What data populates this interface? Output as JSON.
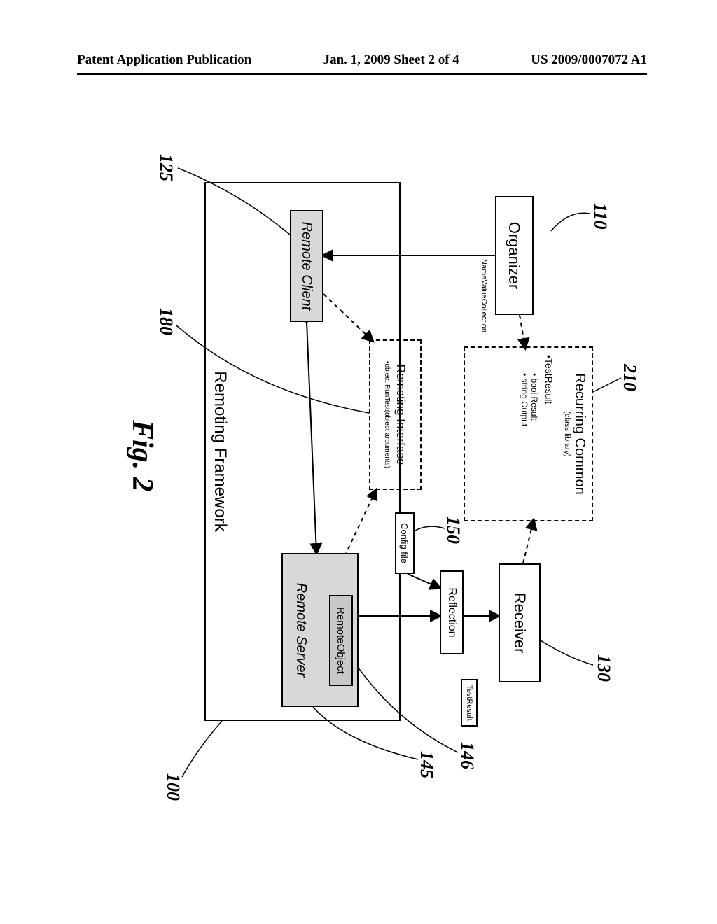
{
  "header": {
    "left": "Patent Application Publication",
    "center": "Jan. 1, 2009  Sheet 2 of 4",
    "right": "US 2009/0007072 A1"
  },
  "figure_caption": "Fig. 2",
  "callouts": {
    "c110": "110",
    "c210": "210",
    "c130": "130",
    "c150": "150",
    "c146": "146",
    "c145": "145",
    "c125": "125",
    "c180": "180",
    "c100": "100"
  },
  "boxes": {
    "organizer": "Organizer",
    "receiver": "Receiver",
    "reflection": "Reflection",
    "config_file": "Config file",
    "test_result_lbl": "TestResult",
    "remote_client": "Remote Client",
    "remote_server": "Remote Server",
    "remote_object": "RemoteObject",
    "remoting_framework": "Remoting Framework",
    "recurring_common_title": "Recurring Common",
    "recurring_common_sub": "(class library)",
    "rc_testresult": "•TestResult",
    "rc_bool": "• bool Result",
    "rc_string": "• string Output",
    "nvc": "NameValueCollection",
    "remoting_interface_title": "Remoting Interface",
    "remoting_interface_method": "•object RunTest(object arguments)"
  }
}
